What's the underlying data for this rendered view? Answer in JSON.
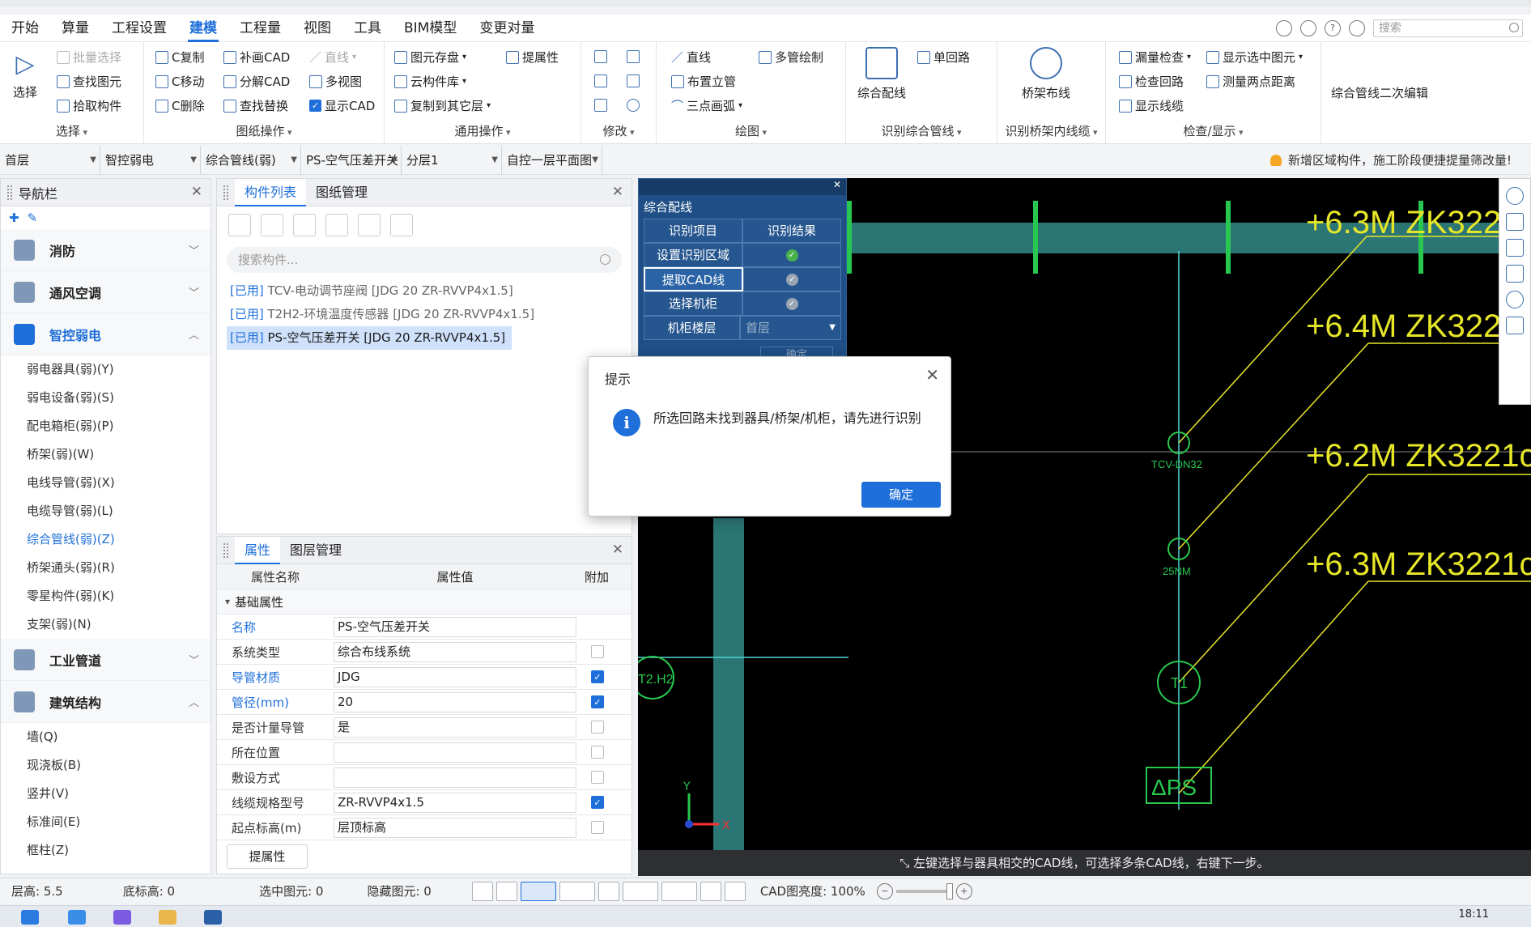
{
  "menu": {
    "items": [
      "开始",
      "算量",
      "工程设置",
      "建模",
      "工程量",
      "视图",
      "工具",
      "BIM模型",
      "变更对量"
    ],
    "active_index": 3,
    "search_placeholder": "搜索"
  },
  "ribbon": {
    "select": {
      "label": "选择",
      "buttons": [
        "批量选择",
        "查找图元",
        "拾取构件"
      ],
      "big": "选择"
    },
    "drawing_ops": {
      "label": "图纸操作",
      "col1": [
        "C复制",
        "C移动",
        "C删除"
      ],
      "col2": [
        "补画CAD",
        "分解CAD",
        "查找替换"
      ],
      "col3": [
        "直线",
        "多视图",
        "显示CAD"
      ]
    },
    "general_ops": {
      "label": "通用操作",
      "col1": [
        "图元存盘",
        "云构件库",
        "复制到其它层"
      ],
      "col2": [
        "提属性"
      ]
    },
    "modify": {
      "label": "修改"
    },
    "draw": {
      "label": "绘图",
      "col1": [
        "直线",
        "布置立管",
        "三点画弧"
      ],
      "col2": [
        "多管绘制"
      ]
    },
    "identify_pipe": {
      "label": "识别综合管线",
      "big": "综合配线",
      "small": "单回路"
    },
    "identify_tray": {
      "label": "识别桥架内线缆",
      "big": "桥架布线"
    },
    "check": {
      "label": "检查/显示",
      "col1": [
        "漏量检查",
        "检查回路",
        "显示线缆"
      ],
      "col2": [
        "显示选中图元",
        "测量两点距离"
      ]
    },
    "secondary": {
      "label": "综合管线二次编辑"
    }
  },
  "selectors": [
    "首层",
    "智控弱电",
    "综合管线(弱)",
    "PS-空气压差开关",
    "分层1",
    "自控一层平面图"
  ],
  "notice": "新增区域构件，施工阶段便捷提量筛改量!",
  "nav": {
    "title": "导航栏",
    "cats": [
      "消防",
      "通风空调",
      "智控弱电",
      "工业管道",
      "建筑结构"
    ],
    "subs_weak": [
      "弱电器具(弱)(Y)",
      "弱电设备(弱)(S)",
      "配电箱柜(弱)(P)",
      "桥架(弱)(W)",
      "电线导管(弱)(X)",
      "电缆导管(弱)(L)",
      "综合管线(弱)(Z)",
      "桥架通头(弱)(R)",
      "零星构件(弱)(K)",
      "支架(弱)(N)"
    ],
    "subs_struct": [
      "墙(Q)",
      "现浇板(B)",
      "竖井(V)",
      "标准间(E)",
      "框柱(Z)"
    ]
  },
  "components": {
    "tabs": [
      "构件列表",
      "图纸管理"
    ],
    "search_placeholder": "搜索构件...",
    "items": [
      {
        "tag": "[已用]",
        "text": " TCV-电动调节座阀 [JDG 20 ZR-RVVP4x1.5]"
      },
      {
        "tag": "[已用]",
        "text": " T2H2-环境温度传感器 [JDG 20 ZR-RVVP4x1.5]"
      },
      {
        "tag": "[已用]",
        "text": " PS-空气压差开关 [JDG 20 ZR-RVVP4x1.5]"
      }
    ]
  },
  "props": {
    "tabs": [
      "属性",
      "图层管理"
    ],
    "headers": [
      "属性名称",
      "属性值",
      "附加"
    ],
    "section": "基础属性",
    "rows": [
      {
        "name": "名称",
        "value": "PS-空气压差开关",
        "blue": true,
        "chk": null
      },
      {
        "name": "系统类型",
        "value": "综合布线系统",
        "blue": false,
        "chk": false
      },
      {
        "name": "导管材质",
        "value": "JDG",
        "blue": true,
        "chk": true
      },
      {
        "name": "管径(mm)",
        "value": "20",
        "blue": true,
        "chk": true
      },
      {
        "name": "是否计量导管",
        "value": "是",
        "blue": false,
        "chk": false
      },
      {
        "name": "所在位置",
        "value": "",
        "blue": false,
        "chk": false
      },
      {
        "name": "敷设方式",
        "value": "",
        "blue": false,
        "chk": false
      },
      {
        "name": "线缆规格型号",
        "value": "ZR-RVVP4x1.5",
        "blue": false,
        "chk": true
      },
      {
        "name": "起点标高(m)",
        "value": "层顶标高",
        "blue": false,
        "chk": false
      }
    ],
    "button": "提属性"
  },
  "wizard": {
    "title": "综合配线",
    "headers": [
      "识别项目",
      "识别结果"
    ],
    "rows": [
      "设置识别区域",
      "提取CAD线",
      "选择机柜",
      "机柜楼层"
    ],
    "floor_value": "首层",
    "confirm": "确定"
  },
  "cad": {
    "labels": [
      "+6.3M ZK322",
      "+6.4M ZK322",
      "+6.2M ZK3221c",
      "+6.3M ZK3221c"
    ],
    "devices": [
      "TCV-DN32",
      "25NM",
      "T1",
      "ΔPS",
      "T2.H2"
    ],
    "status": "左键选择与器具相交的CAD线，可选择多条CAD线，右键下一步。",
    "axis_x": "X",
    "axis_y": "Y"
  },
  "dialog": {
    "title": "提示",
    "message": "所选回路未找到器具/桥架/机柜，请先进行识别",
    "ok": "确定"
  },
  "statusbar": {
    "floor_height": "层高: 5.5",
    "bottom_elev": "底标高: 0",
    "selected": "选中图元: 0",
    "hidden": "隐藏图元: 0",
    "cad_brightness": "CAD图亮度: 100%"
  },
  "clock": "18:11",
  "colors": {
    "accent": "#1e6fd9",
    "cad_bg": "#000000",
    "pipe": "#4fd6d6",
    "lead": "#e6e629",
    "device": "#28c850"
  }
}
